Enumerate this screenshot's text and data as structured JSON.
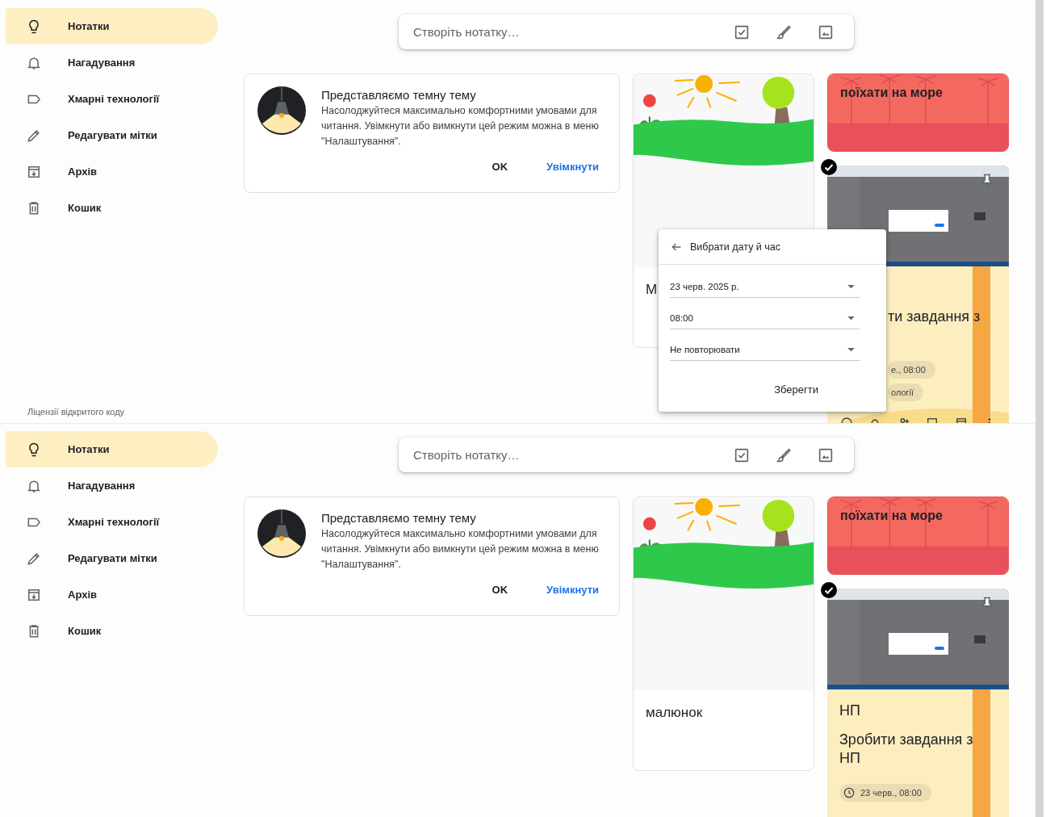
{
  "panels": [
    {
      "sidebar": {
        "items": [
          {
            "label": "Нотатки",
            "selected": true
          },
          {
            "label": "Нагадування",
            "selected": false
          },
          {
            "label": "Хмарні технології",
            "selected": false
          },
          {
            "label": "Редагувати мітки",
            "selected": false
          },
          {
            "label": "Архів",
            "selected": false
          },
          {
            "label": "Кошик",
            "selected": false
          }
        ],
        "footer": "Ліцензії відкритого коду"
      },
      "search": {
        "placeholder": "Створіть нотатку…"
      },
      "banner": {
        "title": "Представляємо темну тему",
        "text": "Насолоджуйтеся максимально комфортними умовами для читання. Увімкнути або вимкнути цей режим можна в меню \"Налаштування\".",
        "buttons": [
          {
            "label": "OK",
            "kind": "plain"
          },
          {
            "label": "Увімкнути",
            "kind": "primary"
          }
        ]
      },
      "drawing_note": {
        "title": "М"
      },
      "sea_note": {
        "title": "поїхати на море"
      },
      "task_note": {
        "checked": true,
        "pinned": true,
        "text": "ти завдання з",
        "chips": [
          {
            "label": "е., 08:00",
            "kind": "label"
          },
          {
            "label": "ології",
            "kind": "label"
          }
        ],
        "toolbar": true
      },
      "dialog": {
        "title": "Вибрати дату й час",
        "fields": [
          "23 черв. 2025 р.",
          "08:00",
          "Не повторювати"
        ],
        "save": "Зберегти"
      }
    },
    {
      "sidebar": {
        "items": [
          {
            "label": "Нотатки",
            "selected": true
          },
          {
            "label": "Нагадування",
            "selected": false
          },
          {
            "label": "Хмарні технології",
            "selected": false
          },
          {
            "label": "Редагувати мітки",
            "selected": false
          },
          {
            "label": "Архів",
            "selected": false
          },
          {
            "label": "Кошик",
            "selected": false
          }
        ]
      },
      "search": {
        "placeholder": "Створіть нотатку…"
      },
      "banner": {
        "title": "Представляємо темну тему",
        "text": "Насолоджуйтеся максимально комфортними умовами для читання. Увімкнути або вимкнути цей режим можна в меню \"Налаштування\".",
        "buttons": [
          {
            "label": "OK",
            "kind": "plain"
          },
          {
            "label": "Увімкнути",
            "kind": "primary"
          }
        ]
      },
      "drawing_note": {
        "title": "малюнок"
      },
      "sea_note": {
        "title": "поїхати на море"
      },
      "task_note": {
        "checked": true,
        "pinned": true,
        "title": "НП",
        "text": "Зробити завдання з НП",
        "chips": [
          {
            "label": "23 черв., 08:00",
            "kind": "reminder"
          }
        ],
        "toolbar": false
      }
    }
  ]
}
